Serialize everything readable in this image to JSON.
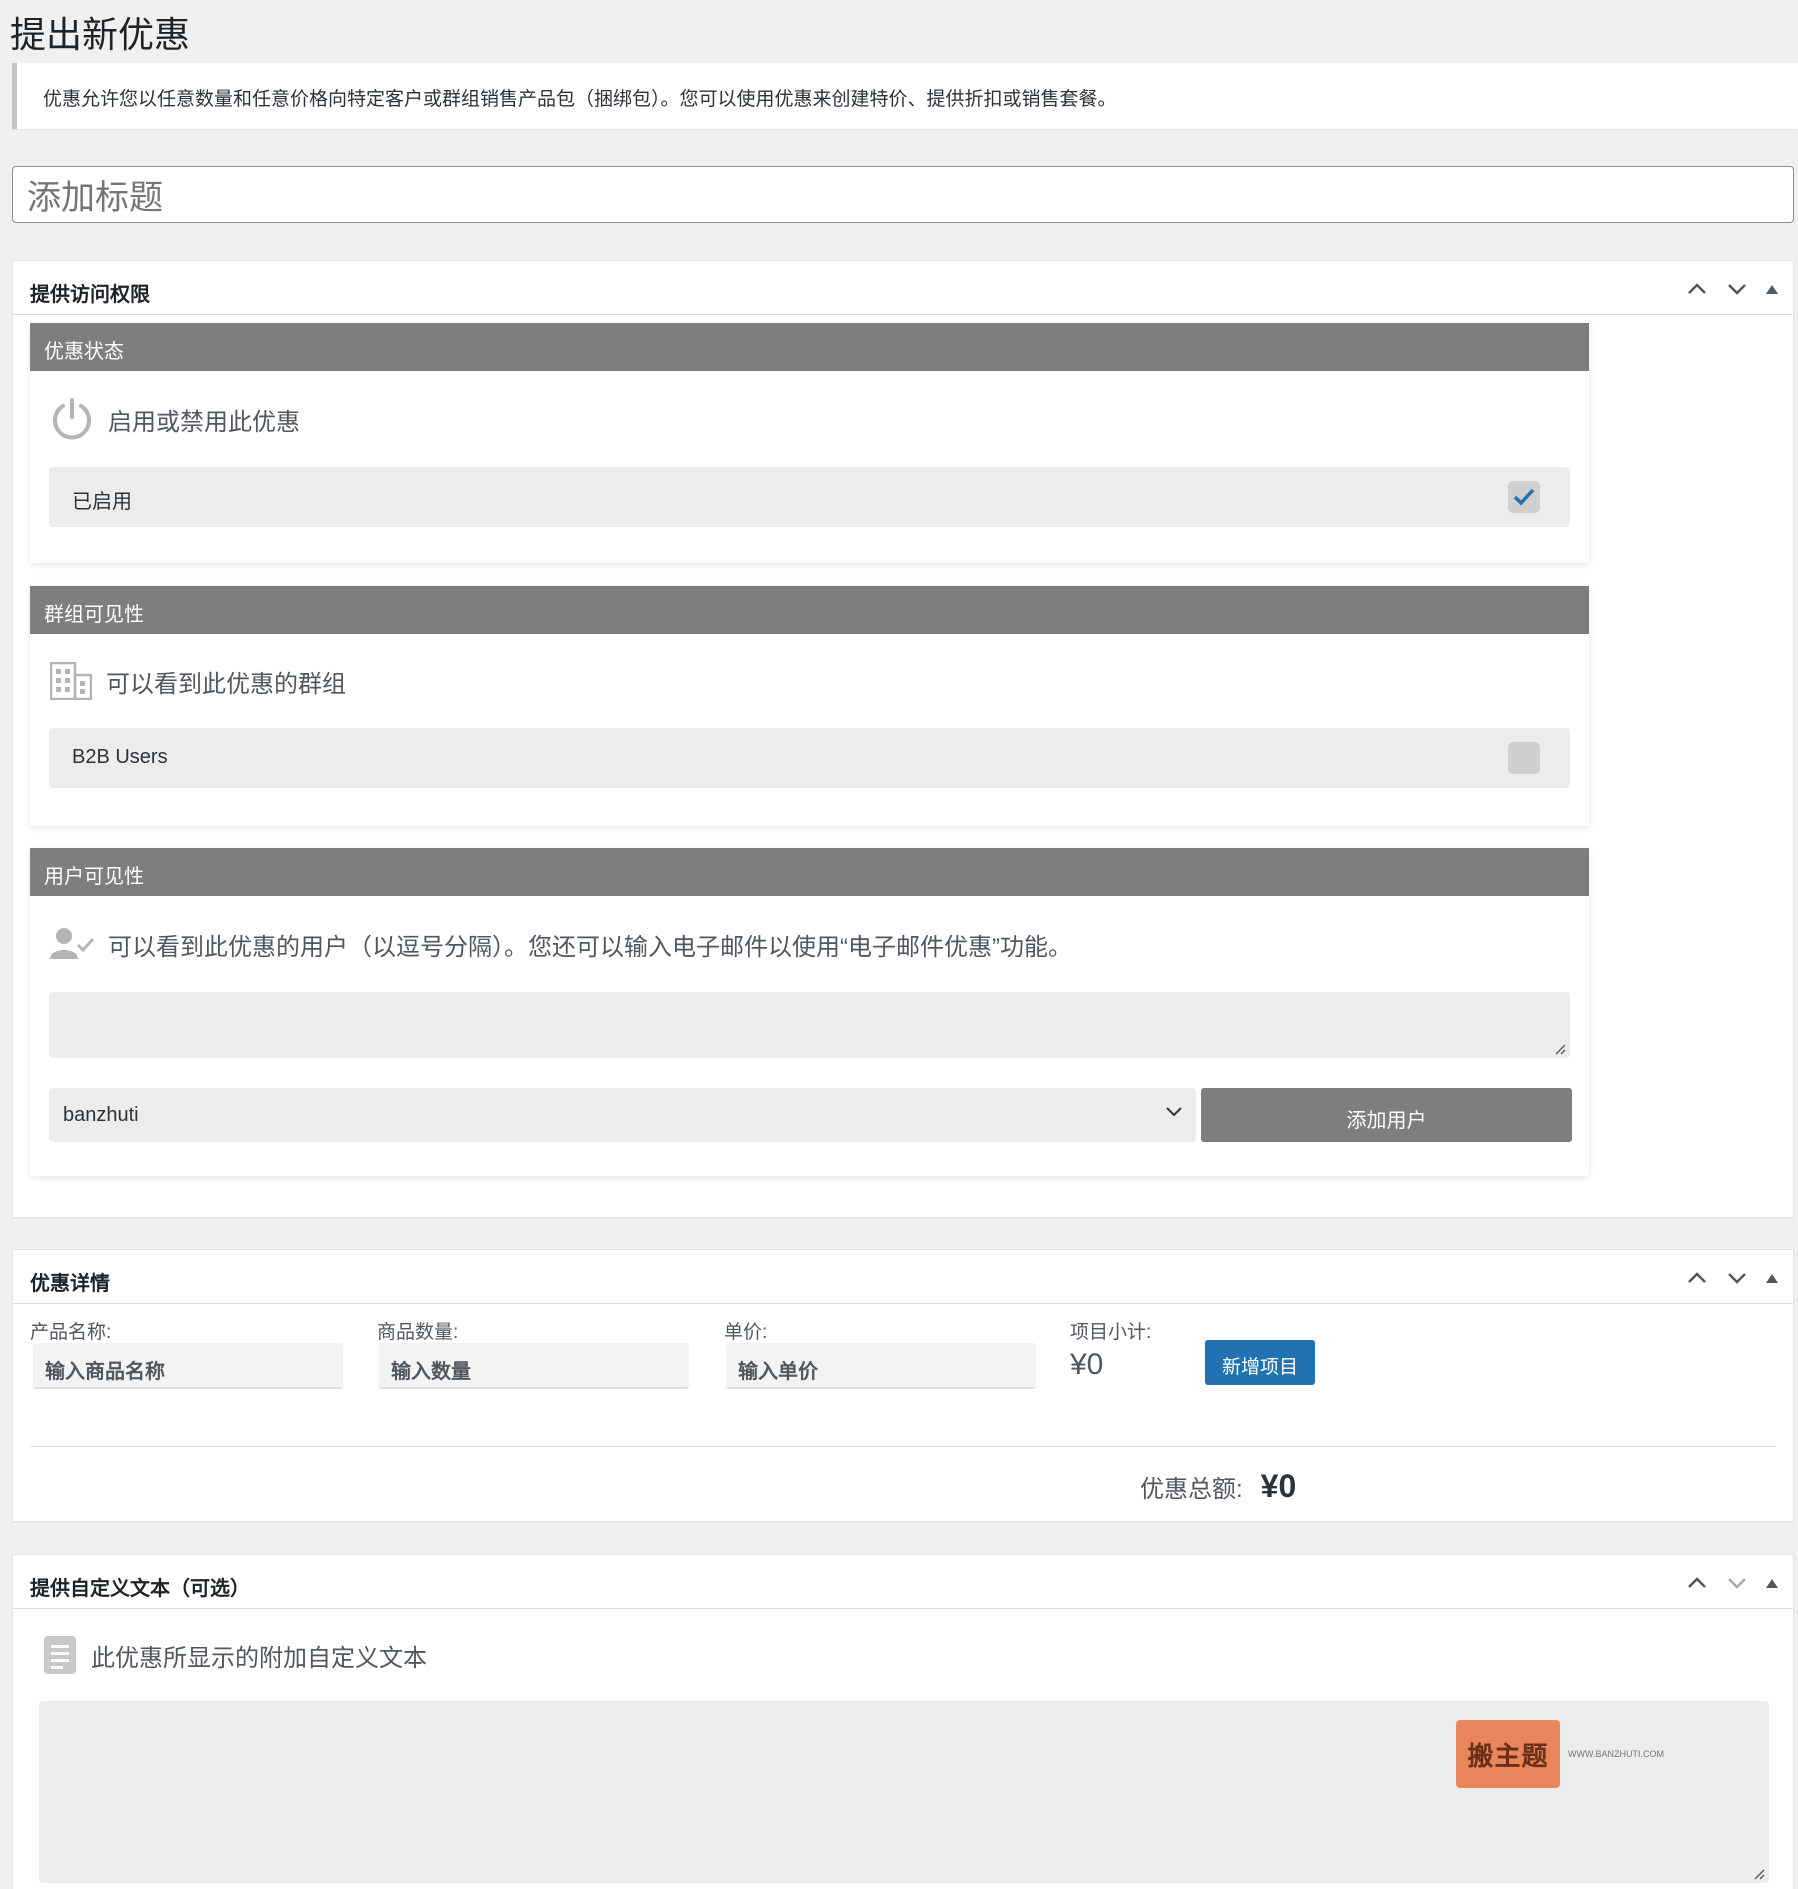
{
  "page": {
    "title": "提出新优惠",
    "notice": "优惠允许您以任意数量和任意价格向特定客户或群组销售产品包（捆绑包）。您可以使用优惠来创建特价、提供折扣或销售套餐。",
    "title_placeholder": "添加标题"
  },
  "access_box": {
    "title": "提供访问权限",
    "status_card": {
      "header": "优惠状态",
      "subtitle": "启用或禁用此优惠",
      "icon": "power-icon",
      "option_label": "已启用",
      "option_checked": true
    },
    "group_card": {
      "header": "群组可见性",
      "subtitle": "可以看到此优惠的群组",
      "icon": "building-icon",
      "option_label": "B2B Users",
      "option_checked": false
    },
    "user_card": {
      "header": "用户可见性",
      "subtitle": "可以看到此优惠的用户（以逗号分隔）。您还可以输入电子邮件以使用“电子邮件优惠”功能。",
      "icon": "user-check-icon",
      "textarea_value": "",
      "selected_user": "banzhuti",
      "add_user_label": "添加用户"
    }
  },
  "details_box": {
    "title": "优惠详情",
    "product_name_label": "产品名称:",
    "product_name_placeholder": "输入商品名称",
    "quantity_label": "商品数量:",
    "quantity_placeholder": "输入数量",
    "unit_price_label": "单价:",
    "unit_price_placeholder": "输入单价",
    "subtotal_label": "项目小计:",
    "subtotal_value": "¥0",
    "add_item_label": "新增项目",
    "total_label": "优惠总额:",
    "total_value": "¥0"
  },
  "custom_text_box": {
    "title": "提供自定义文本（可选）",
    "subtitle": "此优惠所显示的附加自定义文本",
    "icon": "document-icon",
    "textarea_value": ""
  },
  "watermark": {
    "brand": "搬主题",
    "url": "WWW.BANZHUTI.COM"
  },
  "colors": {
    "card_header": "#7e7e7e",
    "primary_button": "#2271b1",
    "checkbox_check": "#2271b1"
  }
}
